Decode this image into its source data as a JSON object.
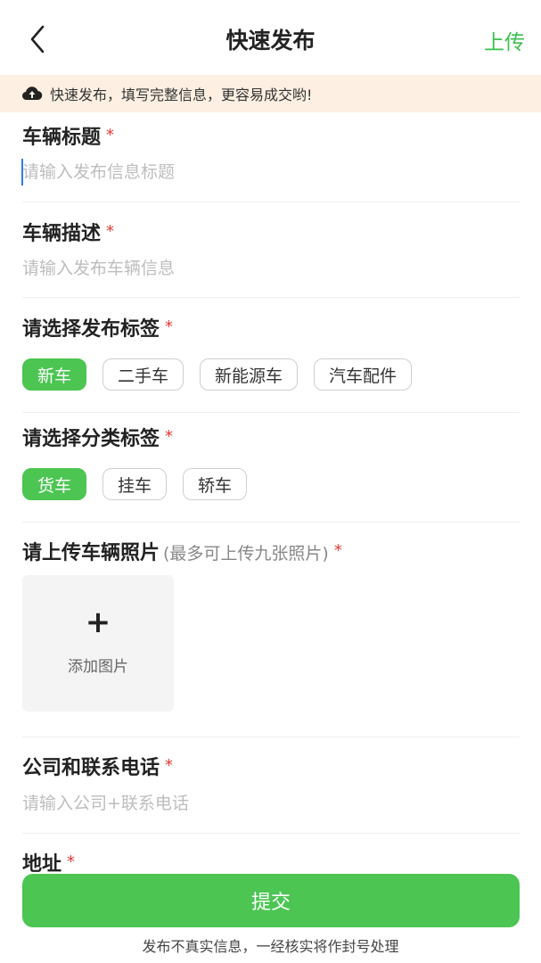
{
  "header": {
    "title": "快速发布",
    "upload_label": "上传"
  },
  "banner": {
    "text": "快速发布，填写完整信息，更容易成交哟!"
  },
  "required_mark": "*",
  "form": {
    "title_field": {
      "label": "车辆标题",
      "placeholder": "请输入发布信息标题"
    },
    "description_field": {
      "label": "车辆描述",
      "placeholder": "请输入发布车辆信息"
    },
    "publish_tags": {
      "label": "请选择发布标签",
      "options": [
        "新车",
        "二手车",
        "新能源车",
        "汽车配件"
      ],
      "selected": "新车"
    },
    "category_tags": {
      "label": "请选择分类标签",
      "options": [
        "货车",
        "挂车",
        "轿车"
      ],
      "selected": "货车"
    },
    "photos": {
      "label": "请上传车辆照片",
      "note": "(最多可上传九张照片)",
      "add_label": "添加图片",
      "add_symbol": "+"
    },
    "contact_field": {
      "label": "公司和联系电话",
      "placeholder": "请输入公司+联系电话"
    },
    "address_field": {
      "label": "地址"
    }
  },
  "submit": {
    "label": "提交",
    "color": "#4cc553"
  },
  "footer": {
    "note": "发布不真实信息，一经核实将作封号处理"
  },
  "colors": {
    "accent": "#4cc553",
    "required": "#e53935",
    "banner_bg": "#fdf0e2"
  },
  "icons": {
    "back": "chevron-left-icon",
    "banner": "cloud-upload-icon"
  }
}
